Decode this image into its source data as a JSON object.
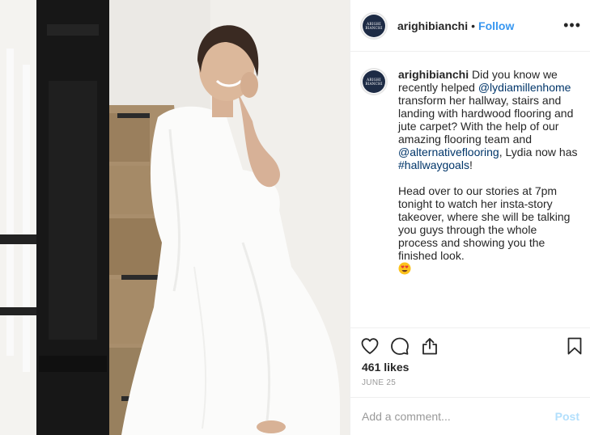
{
  "photo": {
    "description_icon": "photo-image",
    "bg_color": "#eceae6"
  },
  "header": {
    "avatar_text_line1": "ARIGHI",
    "avatar_text_line2": "BIANCHI",
    "username": "arighibianchi",
    "separator": "•",
    "follow_label": "Follow",
    "more_icon": "more-horizontal-icon",
    "more_label": "•••"
  },
  "caption": {
    "username": "arighibianchi",
    "text_1": " Did you know we recently helped ",
    "mention_1": "@lydiamillenhome",
    "text_2": " transform her hallway, stairs and landing with hardwood flooring and jute carpet? With the help of our amazing flooring team and ",
    "mention_2": "@alternativeflooring",
    "text_3": ", Lydia now has ",
    "hashtag": "#hallwaygoals",
    "text_4": "!",
    "paragraph_2": "Head over to our stories at 7pm tonight to watch her insta-story takeover, where she will be talking you guys through the whole process and showing you the finished look.",
    "emoji_icon": "heart-eyes-emoji"
  },
  "actions": {
    "like_icon": "heart-icon",
    "comment_icon": "comment-icon",
    "share_icon": "share-icon",
    "save_icon": "bookmark-icon"
  },
  "likes": "461 likes",
  "date": "JUNE 25",
  "comment": {
    "placeholder": "Add a comment...",
    "post_label": "Post"
  },
  "colors": {
    "accent": "#3897f0",
    "mention": "#003569",
    "post_disabled": "#b2dffc",
    "brand_navy": "#1d2b45"
  }
}
